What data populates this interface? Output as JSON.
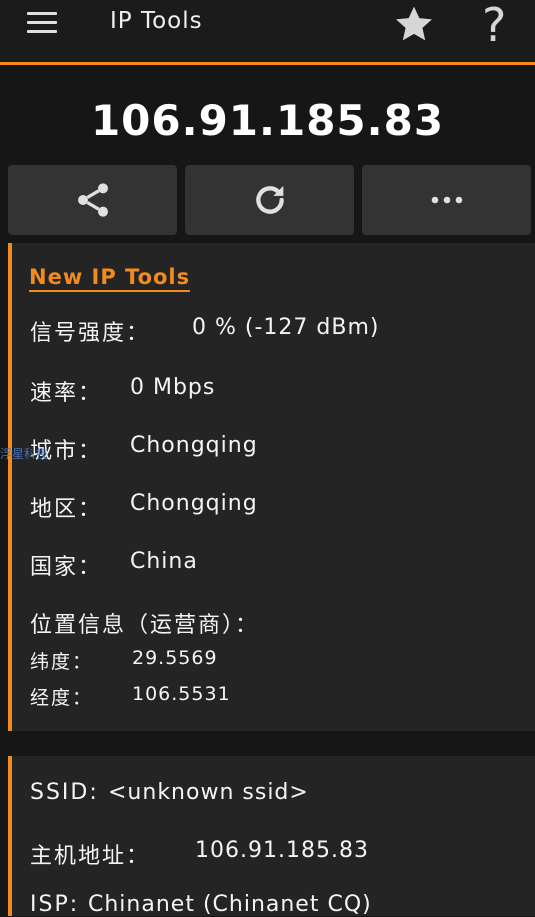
{
  "appbar": {
    "title": "IP Tools",
    "menu_icon": "hamburger-menu-icon",
    "favorite_icon": "star-icon",
    "help_glyph": "?"
  },
  "ip_address": "106.91.185.83",
  "actions": [
    {
      "icon": "share-icon"
    },
    {
      "icon": "refresh-icon"
    },
    {
      "icon": "more-dots-icon"
    }
  ],
  "info_card": {
    "heading": "New IP Tools",
    "signal_label": "信号强度：",
    "signal_value": "0 % (-127 dBm)",
    "speed_label": "速率：",
    "speed_value": "0 Mbps",
    "city_label": "城市：",
    "city_value": "Chongqing",
    "region_label": "地区：",
    "region_value": "Chongqing",
    "country_label": "国家：",
    "country_value": "China",
    "location_heading": "位置信息（运营商）：",
    "lat_label": "纬度：",
    "lat_value": "29.5569",
    "lon_label": "经度：",
    "lon_value": "106.5531"
  },
  "network_card": {
    "ssid_label": "SSID:",
    "ssid_value": "<unknown ssid>",
    "host_label": "主机地址：",
    "host_value": "106.91.185.83",
    "isp_label": "ISP:",
    "isp_value": "Chinanet (Chinanet CQ)"
  },
  "watermark": "浮星科技",
  "colors": {
    "accent": "#f28b1f",
    "background": "#161616",
    "card": "#242424",
    "button": "#333333"
  }
}
